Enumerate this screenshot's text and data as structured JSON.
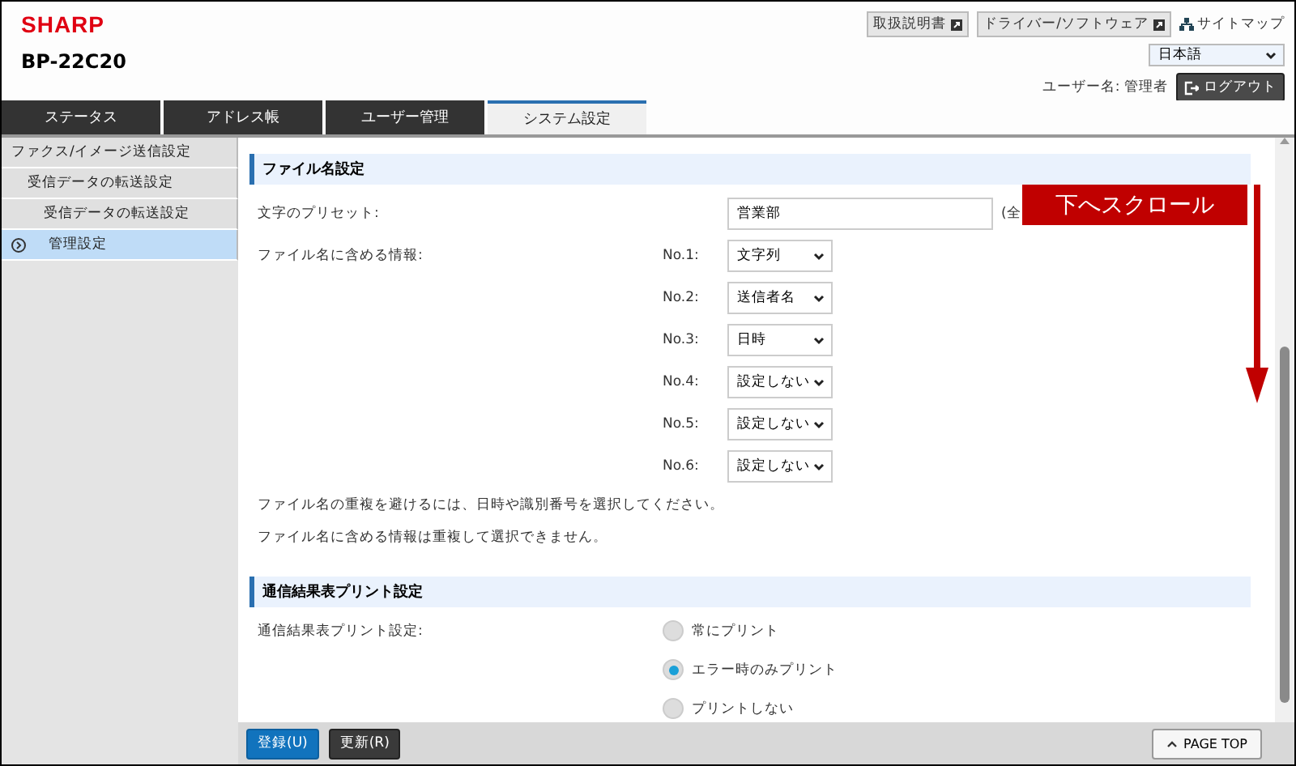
{
  "header": {
    "logo": "SHARP",
    "model": "BP-22C20",
    "links": [
      {
        "label": "取扱説明書"
      },
      {
        "label": "ドライバー/ソフトウェア"
      }
    ],
    "sitemap": "サイトマップ",
    "language": "日本語",
    "user_label": "ユーザー名: 管理者",
    "logout": "ログアウト"
  },
  "tabs": [
    {
      "label": "ステータス",
      "selected": false
    },
    {
      "label": "アドレス帳",
      "selected": false
    },
    {
      "label": "ユーザー管理",
      "selected": false
    },
    {
      "label": "システム設定",
      "selected": true
    }
  ],
  "sidebar": {
    "items": [
      {
        "label": "ファクス/イメージ送信設定",
        "selected": false,
        "children": [
          {
            "label": "受信データの転送設定",
            "selected": false,
            "children": [
              {
                "label": "受信データの転送設定",
                "selected": false
              },
              {
                "label": "管理設定",
                "selected": true
              }
            ]
          }
        ]
      }
    ]
  },
  "filename_section": {
    "title": "ファイル名設定",
    "preset_label": "文字のプリセット:",
    "preset_value": "営業部",
    "preset_note": "(全",
    "info_label": "ファイル名に含める情報:",
    "slots": [
      {
        "label": "No.1:",
        "value": "文字列"
      },
      {
        "label": "No.2:",
        "value": "送信者名"
      },
      {
        "label": "No.3:",
        "value": "日時"
      },
      {
        "label": "No.4:",
        "value": "設定しない"
      },
      {
        "label": "No.5:",
        "value": "設定しない"
      },
      {
        "label": "No.6:",
        "value": "設定しない"
      }
    ],
    "notes": [
      "ファイル名の重複を避けるには、日時や識別番号を選択してください。",
      "ファイル名に含める情報は重複して選択できません。"
    ]
  },
  "print_section": {
    "title": "通信結果表プリント設定",
    "label": "通信結果表プリント設定:",
    "options": [
      {
        "label": "常にプリント",
        "selected": false
      },
      {
        "label": "エラー時のみプリント",
        "selected": true
      },
      {
        "label": "プリントしない",
        "selected": false
      }
    ]
  },
  "footer": {
    "buttons": [
      {
        "label": "登録(U)",
        "kind": "primary"
      },
      {
        "label": "更新(R)",
        "kind": "dark"
      }
    ],
    "page_top": "PAGE TOP"
  },
  "callout": {
    "label": "下へスクロール"
  }
}
